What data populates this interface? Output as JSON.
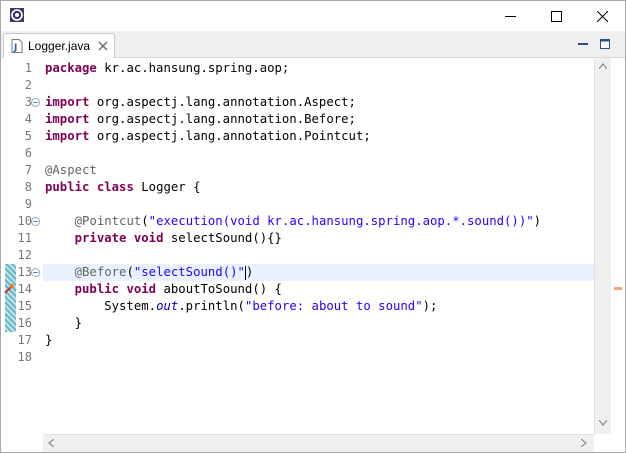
{
  "window": {
    "title": ""
  },
  "colors": {
    "keyword": "#7f0055",
    "annotation": "#646464",
    "string": "#2a00ff",
    "field": "#0000c0",
    "current_line": "#e8f2fe",
    "overview_marker": "#f6a46a"
  },
  "tab": {
    "label": "Logger.java",
    "icon": "java-file-icon"
  },
  "editor": {
    "current_line": 13,
    "lines": [
      {
        "num": "1",
        "tokens": [
          [
            "kw",
            "package"
          ],
          [
            "t",
            " kr.ac.hansung.spring.aop;"
          ]
        ]
      },
      {
        "num": "2",
        "tokens": []
      },
      {
        "num": "3",
        "fold": true,
        "tokens": [
          [
            "kw",
            "import"
          ],
          [
            "t",
            " org.aspectj.lang.annotation.Aspect;"
          ]
        ]
      },
      {
        "num": "4",
        "tokens": [
          [
            "kw",
            "import"
          ],
          [
            "t",
            " org.aspectj.lang.annotation.Before;"
          ]
        ]
      },
      {
        "num": "5",
        "tokens": [
          [
            "kw",
            "import"
          ],
          [
            "t",
            " org.aspectj.lang.annotation.Pointcut;"
          ]
        ]
      },
      {
        "num": "6",
        "tokens": []
      },
      {
        "num": "7",
        "tokens": [
          [
            "anno",
            "@Aspect"
          ]
        ]
      },
      {
        "num": "8",
        "tokens": [
          [
            "kw",
            "public"
          ],
          [
            "t",
            " "
          ],
          [
            "kw",
            "class"
          ],
          [
            "t",
            " Logger {"
          ]
        ]
      },
      {
        "num": "9",
        "tokens": []
      },
      {
        "num": "10",
        "fold": true,
        "tokens": [
          [
            "t",
            "    "
          ],
          [
            "anno",
            "@Pointcut"
          ],
          [
            "t",
            "("
          ],
          [
            "str",
            "\"execution(void kr.ac.hansung.spring.aop.*.sound())\""
          ],
          [
            "t",
            ")"
          ]
        ]
      },
      {
        "num": "11",
        "tokens": [
          [
            "t",
            "    "
          ],
          [
            "kw",
            "private"
          ],
          [
            "t",
            " "
          ],
          [
            "kw",
            "void"
          ],
          [
            "t",
            " selectSound(){}"
          ]
        ]
      },
      {
        "num": "12",
        "tokens": []
      },
      {
        "num": "13",
        "fold": true,
        "tokens": [
          [
            "t",
            "    "
          ],
          [
            "anno",
            "@Before"
          ],
          [
            "t",
            "("
          ],
          [
            "str",
            "\"selectSound()\""
          ],
          [
            "cursor",
            ""
          ],
          [
            "t",
            ")"
          ]
        ]
      },
      {
        "num": "14",
        "tokens": [
          [
            "t",
            "    "
          ],
          [
            "kw",
            "public"
          ],
          [
            "t",
            " "
          ],
          [
            "kw",
            "void"
          ],
          [
            "t",
            " aboutToSound() {"
          ]
        ]
      },
      {
        "num": "15",
        "tokens": [
          [
            "t",
            "        System."
          ],
          [
            "field",
            "out"
          ],
          [
            "t",
            ".println("
          ],
          [
            "str",
            "\"before: about to sound\""
          ],
          [
            "t",
            ");"
          ]
        ]
      },
      {
        "num": "16",
        "tokens": [
          [
            "t",
            "    }"
          ]
        ]
      },
      {
        "num": "17",
        "tokens": [
          [
            "t",
            "}"
          ]
        ]
      },
      {
        "num": "18",
        "tokens": []
      }
    ]
  }
}
